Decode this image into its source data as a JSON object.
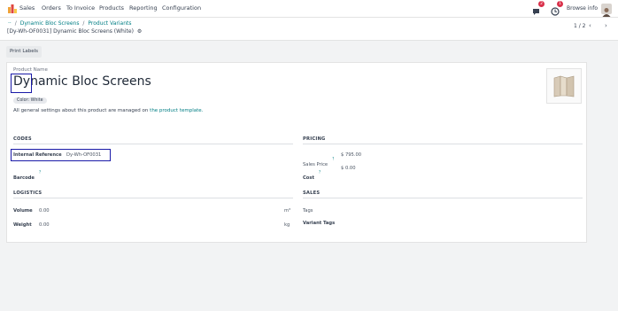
{
  "navbar": {
    "app_name": "Sales",
    "menu": [
      "Orders",
      "To Invoice",
      "Products",
      "Reporting",
      "Configuration"
    ],
    "chat_badge": "2",
    "activity_badge": "1",
    "company": "Browse info"
  },
  "breadcrumb": {
    "parent1": "Dynamic Bloc Screens",
    "parent2": "Product Variants",
    "current": "[Dy-Wh-OF0031] Dynamic Bloc Screens (White)",
    "pager": "1 / 2"
  },
  "controls": {
    "print_labels": "Print Labels"
  },
  "form": {
    "product_name_label": "Product Name",
    "product_name": "Dynamic Bloc Screens",
    "variant_tag": "Color: White",
    "note_text": "All general settings about this product are managed on",
    "note_link": "the product template.",
    "codes": {
      "title": "CODES",
      "internal_reference_label": "Internal Reference",
      "internal_reference": "Dy-Wh-OF0031",
      "barcode_label": "Barcode",
      "barcode_help": "?"
    },
    "pricing": {
      "title": "PRICING",
      "sales_price_label": "Sales Price",
      "sales_price_help": "?",
      "sales_price": "$ 795.00",
      "cost_label": "Cost",
      "cost_help": "?",
      "cost": "$ 0.00"
    },
    "logistics": {
      "title": "LOGISTICS",
      "volume_label": "Volume",
      "volume": "0.00",
      "volume_unit": "m³",
      "weight_label": "Weight",
      "weight": "0.00",
      "weight_unit": "kg"
    },
    "sales": {
      "title": "SALES",
      "tags_label": "Tags",
      "variant_tags_label": "Variant Tags"
    }
  },
  "colors": {
    "accent": "#017e84",
    "highlight": "#1a1aa8",
    "badge": "#d9304a"
  }
}
